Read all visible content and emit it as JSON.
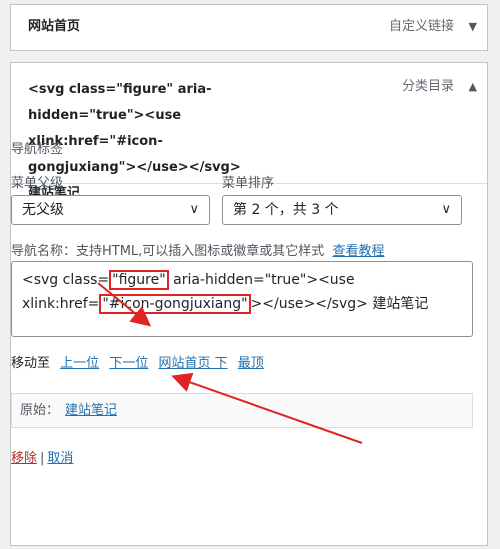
{
  "top_item": {
    "title": "网站首页",
    "type": "自定义链接",
    "arrow": "▼"
  },
  "main_item": {
    "title": "<svg class=\"figure\" aria-hidden=\"true\"><use xlink:href=\"#icon-gongjuxiang\"></use></svg> 建站笔记",
    "type": "分类目录",
    "arrow": "▲"
  },
  "form": {
    "nav_tag_label": "导航标签",
    "parent_label": "菜单父级",
    "parent_value": "无父级",
    "order_label": "菜单排序",
    "order_value": "第 2 个，共 3 个",
    "name_label": "导航名称：支持HTML,可以插入图标或徽章或其它样式",
    "tutorial_link": "查看教程",
    "textarea": {
      "p1": "<svg class=",
      "hl1": "\"figure\"",
      "p2": " aria-hidden=\"true\"><use xlink:href=",
      "hl2": "\"#icon-gongjuxiang\"",
      "p3": "></use></svg> 建站笔记"
    },
    "move_label": "移动至",
    "move_links": [
      "上一位",
      "下一位",
      "网站首页 下",
      "最顶"
    ],
    "original_label": "原始：",
    "original_link": "建站笔记",
    "remove": "移除",
    "separator": "|",
    "cancel": "取消"
  },
  "colors": {
    "link": "#2271b1",
    "remove": "#b32d2e",
    "annotation": "#e02424"
  }
}
